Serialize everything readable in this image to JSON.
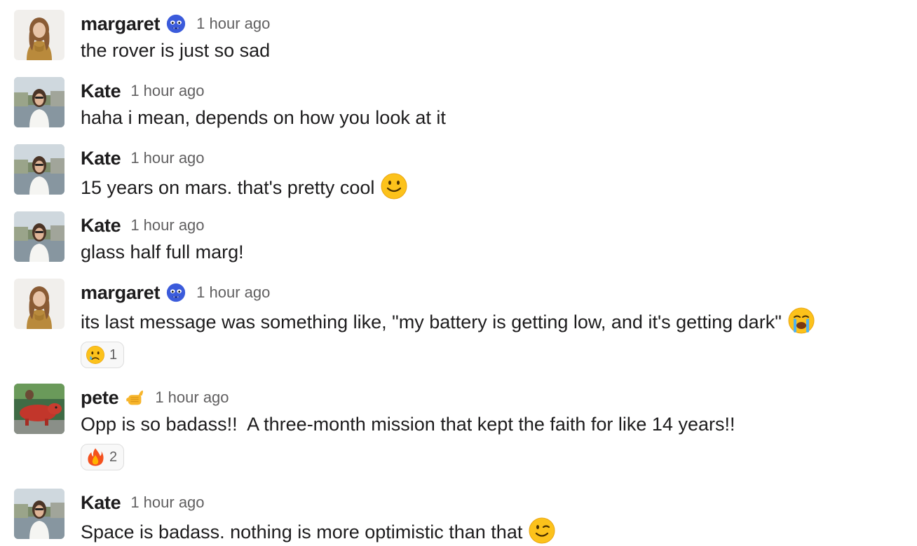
{
  "messages": [
    {
      "author": "margaret",
      "time": "1 hour ago",
      "text": "the rover is just so sad",
      "avatar": "margaret-avatar",
      "status_icon": "goblin-icon"
    },
    {
      "author": "Kate",
      "time": "1 hour ago",
      "text": "haha i mean, depends on how you look at it",
      "avatar": "kate-avatar"
    },
    {
      "author": "Kate",
      "time": "1 hour ago",
      "text": "15 years on mars. that's pretty cool",
      "avatar": "kate-avatar",
      "inline_emoji": "slightly-smiling-face-icon"
    },
    {
      "author": "Kate",
      "time": "1 hour ago",
      "text": "glass half full marg!",
      "avatar": "kate-avatar"
    },
    {
      "author": "margaret",
      "time": "1 hour ago",
      "text": "its last message was something like, \"my battery is getting low, and it's getting dark\"",
      "avatar": "margaret-avatar",
      "status_icon": "goblin-icon",
      "inline_emoji": "loudly-crying-face-icon",
      "reaction": {
        "emoji": "crying-face-icon",
        "count": "1"
      }
    },
    {
      "author": "pete",
      "time": "1 hour ago",
      "text": "Opp is so badass!!  A three-month mission that kept the faith for like 14 years!!",
      "avatar": "pete-avatar",
      "status_icon": "call-me-hand-icon",
      "reaction": {
        "emoji": "fire-icon",
        "count": "2"
      }
    },
    {
      "author": "Kate",
      "time": "1 hour ago",
      "text": "Space is badass. nothing is more optimistic than that",
      "avatar": "kate-avatar",
      "inline_emoji": "winking-face-icon"
    }
  ],
  "colors": {
    "text": "#1d1c1d",
    "meta": "#616061",
    "reaction_border": "#dddddd",
    "reaction_bg": "#f8f8f8"
  }
}
